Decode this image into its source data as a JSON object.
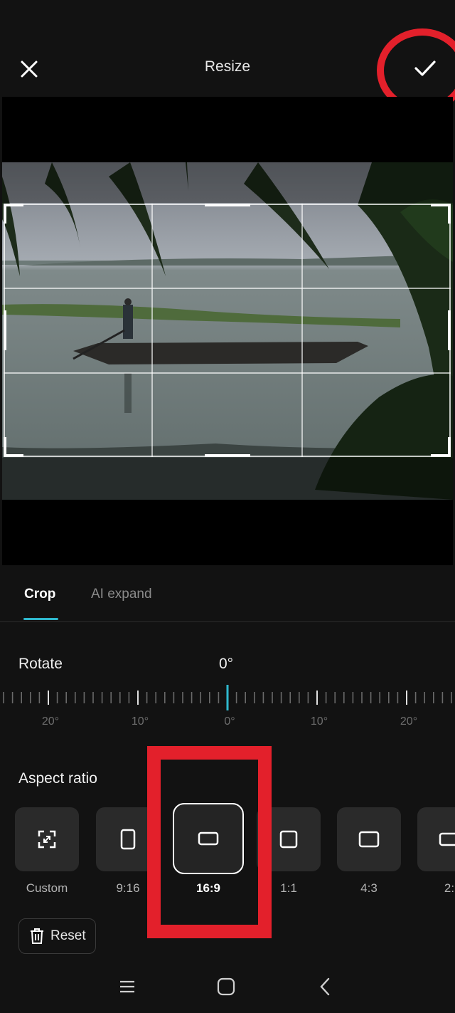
{
  "header": {
    "title": "Resize"
  },
  "tabs": [
    {
      "label": "Crop",
      "active": true
    },
    {
      "label": "AI expand",
      "active": false
    }
  ],
  "rotate": {
    "label": "Rotate",
    "value": "0°",
    "ticks": [
      "20°",
      "10°",
      "0°",
      "10°",
      "20°"
    ]
  },
  "aspect": {
    "label": "Aspect ratio",
    "options": [
      {
        "label": "Custom",
        "icon": "custom-crop-icon",
        "selected": false
      },
      {
        "label": "9:16",
        "icon": "portrait-rect-icon",
        "selected": false
      },
      {
        "label": "16:9",
        "icon": "landscape-rect-icon",
        "selected": true
      },
      {
        "label": "1:1",
        "icon": "square-icon",
        "selected": false
      },
      {
        "label": "4:3",
        "icon": "landscape-rect-icon",
        "selected": false
      },
      {
        "label": "2:",
        "icon": "landscape-rect-icon",
        "selected": false
      }
    ]
  },
  "reset": {
    "label": "Reset"
  },
  "colors": {
    "accent": "#2fb8cd",
    "annotation": "#e3202b",
    "background": "#121212"
  }
}
